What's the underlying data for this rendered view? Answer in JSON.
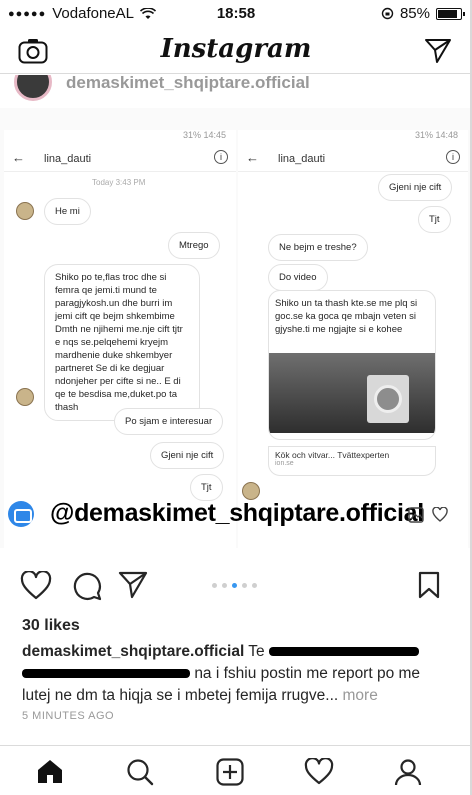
{
  "status_bar": {
    "carrier": "VodafoneAL",
    "time": "18:58",
    "battery": "85%",
    "battery_level": 0.85
  },
  "header": {
    "logo": "Instagram"
  },
  "prev_post": {
    "username": "demaskimet_shqiptare.official"
  },
  "screenshot": {
    "left_panel": {
      "status": "31% 14:45",
      "chat_user": "lina_dauti",
      "timestamp": "Today 3:43 PM",
      "messages": [
        "He mi",
        "Mtrego",
        "Shiko po te,flas troc dhe si femra qe jemi.ti mund te paragjykosh.un dhe burri im jemi cift qe bejm shkembime Dmth ne njihemi me.nje cift tjtr e nqs se.pelqehemi kryejm mardhenie duke shkembyer partneret Se di ke degjuar ndonjeher per cifte si ne.. E di qe te besdisa me,duket.po ta thash",
        "Po sjam e interesuar",
        "Gjeni nje cift",
        "Tjt"
      ]
    },
    "right_panel": {
      "status": "31% 14:48",
      "chat_user": "lina_dauti",
      "messages": [
        "Gjeni nje cift",
        "Tjt",
        "Ne bejm e treshe?",
        "Do video",
        "Shiko un ta thash kte.se me plq si goc.se ka goca qe mbajn veten si gjyshe.ti me ngjajte si e kohee"
      ],
      "link_title": "Kök och vitvar... Tvättexperten",
      "link_domain": "ion.se"
    },
    "watermark": "@demaskimet_shqiptare.official"
  },
  "post": {
    "likes": "30 likes",
    "caption_user": "demaskimet_shqiptare.official",
    "caption_start": "Te",
    "caption_mid": "na i fshiu postin me report po me lutej ne dm ta hiqja se i mbetej femija rrugve...",
    "more": "more",
    "time_ago": "5 MINUTES AGO",
    "carousel_dots": 5,
    "carousel_active": 2
  },
  "icons": {
    "camera": "camera-icon",
    "direct": "paper-plane-icon",
    "like": "heart-icon",
    "comment": "comment-icon",
    "share": "share-icon",
    "save": "bookmark-icon",
    "home": "home-icon",
    "search": "search-icon",
    "add": "add-post-icon",
    "activity": "heart-icon",
    "profile": "profile-icon"
  },
  "colors": {
    "accent": "#3897f0",
    "text": "#262626",
    "muted": "#999999"
  }
}
